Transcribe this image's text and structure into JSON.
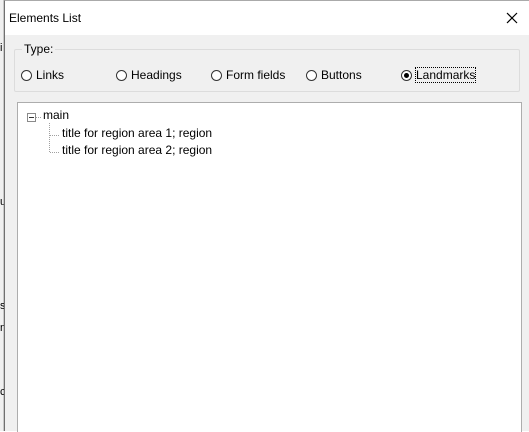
{
  "background_fragments": [
    "i",
    "u",
    "s",
    "n",
    "c"
  ],
  "dialog": {
    "title": "Elements List",
    "close_label": "×"
  },
  "type_group": {
    "label": "Type:",
    "options": [
      {
        "label": "Links",
        "checked": false
      },
      {
        "label": "Headings",
        "checked": false
      },
      {
        "label": "Form fields",
        "checked": false
      },
      {
        "label": "Buttons",
        "checked": false
      },
      {
        "label": "Landmarks",
        "checked": true
      }
    ]
  },
  "tree": {
    "root": {
      "label": "main",
      "expanded": true
    },
    "children": [
      {
        "label": "title for region area 1; region"
      },
      {
        "label": "title for region area 2; region"
      }
    ]
  }
}
